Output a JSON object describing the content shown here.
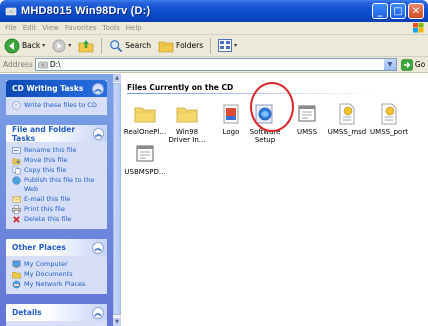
{
  "window": {
    "title": "MHD8015 Win98Drv (D:)",
    "buttons": {
      "minimize": "_",
      "maximize": "□",
      "close": "✕"
    }
  },
  "menubar": {
    "items": [
      "File",
      "Edit",
      "View",
      "Favorites",
      "Tools",
      "Help"
    ]
  },
  "toolbar": {
    "back_label": "Back",
    "search_label": "Search",
    "folders_label": "Folders"
  },
  "address": {
    "label": "Address",
    "value": "D:\\",
    "go_label": "Go"
  },
  "left_pane": {
    "cd_writing": {
      "title": "CD Writing Tasks",
      "items": [
        "Write these files to CD"
      ]
    },
    "file_folder": {
      "title": "File and Folder Tasks",
      "items": [
        "Rename this file",
        "Move this file",
        "Copy this file",
        "Publish this file to the Web",
        "E-mail this file",
        "Print this file",
        "Delete this file"
      ]
    },
    "other_places": {
      "title": "Other Places",
      "items": [
        "My Computer",
        "My Documents",
        "My Network Places"
      ]
    },
    "details": {
      "title": "Details"
    }
  },
  "content": {
    "group_title": "Files Currently on the CD",
    "files": [
      {
        "label": "RealOnePl...",
        "icon": "folder-icon"
      },
      {
        "label": "Win98 Driver In...",
        "icon": "folder-icon"
      },
      {
        "label": "Logo",
        "icon": "image-icon"
      },
      {
        "label": "Software Setup",
        "icon": "setup-icon"
      },
      {
        "label": "UMSS",
        "icon": "app-icon"
      },
      {
        "label": "UMSS_msd",
        "icon": "settings-file-icon"
      },
      {
        "label": "UMSS_port",
        "icon": "settings-file-icon"
      },
      {
        "label": "USBMSPD...",
        "icon": "app-icon"
      }
    ]
  },
  "colors": {
    "titlebar": "#0a46c4",
    "taskpane": "#6f8ce0",
    "link": "#215dc6",
    "highlight": "#d8262a"
  }
}
